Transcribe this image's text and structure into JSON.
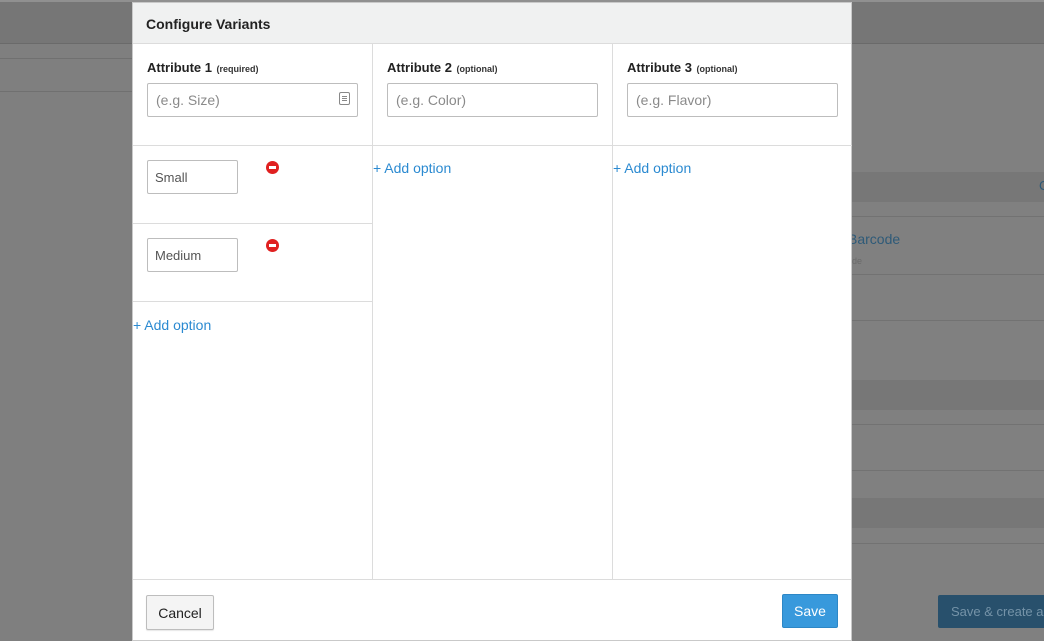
{
  "background": {
    "barcode_text": "Barcode",
    "right_small_text": "de",
    "right_link_fragment": "C",
    "save_create_label": "Save & create a"
  },
  "modal": {
    "title": "Configure Variants",
    "attributes": [
      {
        "label": "Attribute 1",
        "note": "(required)",
        "placeholder": "(e.g. Size)",
        "options": [
          "Small",
          "Medium"
        ],
        "add_option_label": "+ Add option"
      },
      {
        "label": "Attribute 2",
        "note": "(optional)",
        "placeholder": "(e.g. Color)",
        "options": [],
        "add_option_label": "+ Add option"
      },
      {
        "label": "Attribute 3",
        "note": "(optional)",
        "placeholder": "(e.g. Flavor)",
        "options": [],
        "add_option_label": "+ Add option"
      }
    ],
    "footer": {
      "cancel_label": "Cancel",
      "save_label": "Save"
    }
  },
  "colors": {
    "accent": "#3899dc",
    "link": "#2b8ad1",
    "remove": "#e02020"
  }
}
